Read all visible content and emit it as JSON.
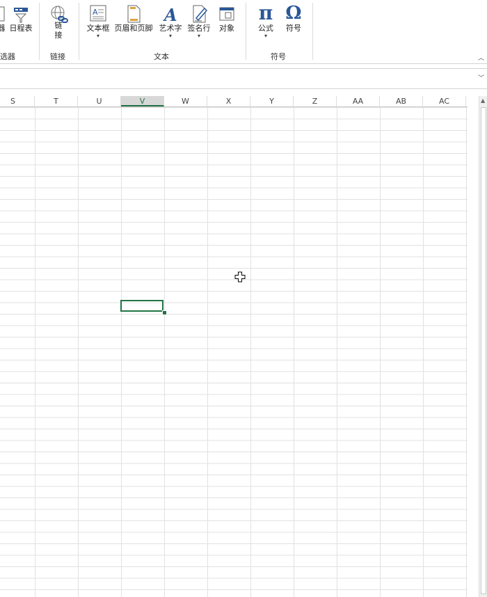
{
  "ribbon": {
    "partial_left_label": "器",
    "timeline_label": "日程表",
    "filter_group_label": "选器",
    "link": {
      "line1": "链",
      "line2": "接",
      "group_label": "链接"
    },
    "text_group": {
      "label": "文本",
      "items": [
        "文本框",
        "页眉和页脚",
        "艺术字",
        "签名行",
        "对象"
      ]
    },
    "symbols_group": {
      "label": "符号",
      "formula_label": "公式",
      "symbol_label": "符号",
      "pi_glyph": "π",
      "omega_glyph": "Ω"
    }
  },
  "sheet": {
    "columns": [
      "S",
      "T",
      "U",
      "V",
      "W",
      "X",
      "Y",
      "Z",
      "AA",
      "AB",
      "AC"
    ],
    "selected_column": "V"
  },
  "colors": {
    "accent": "#217346",
    "icon_blue": "#2b5797"
  }
}
